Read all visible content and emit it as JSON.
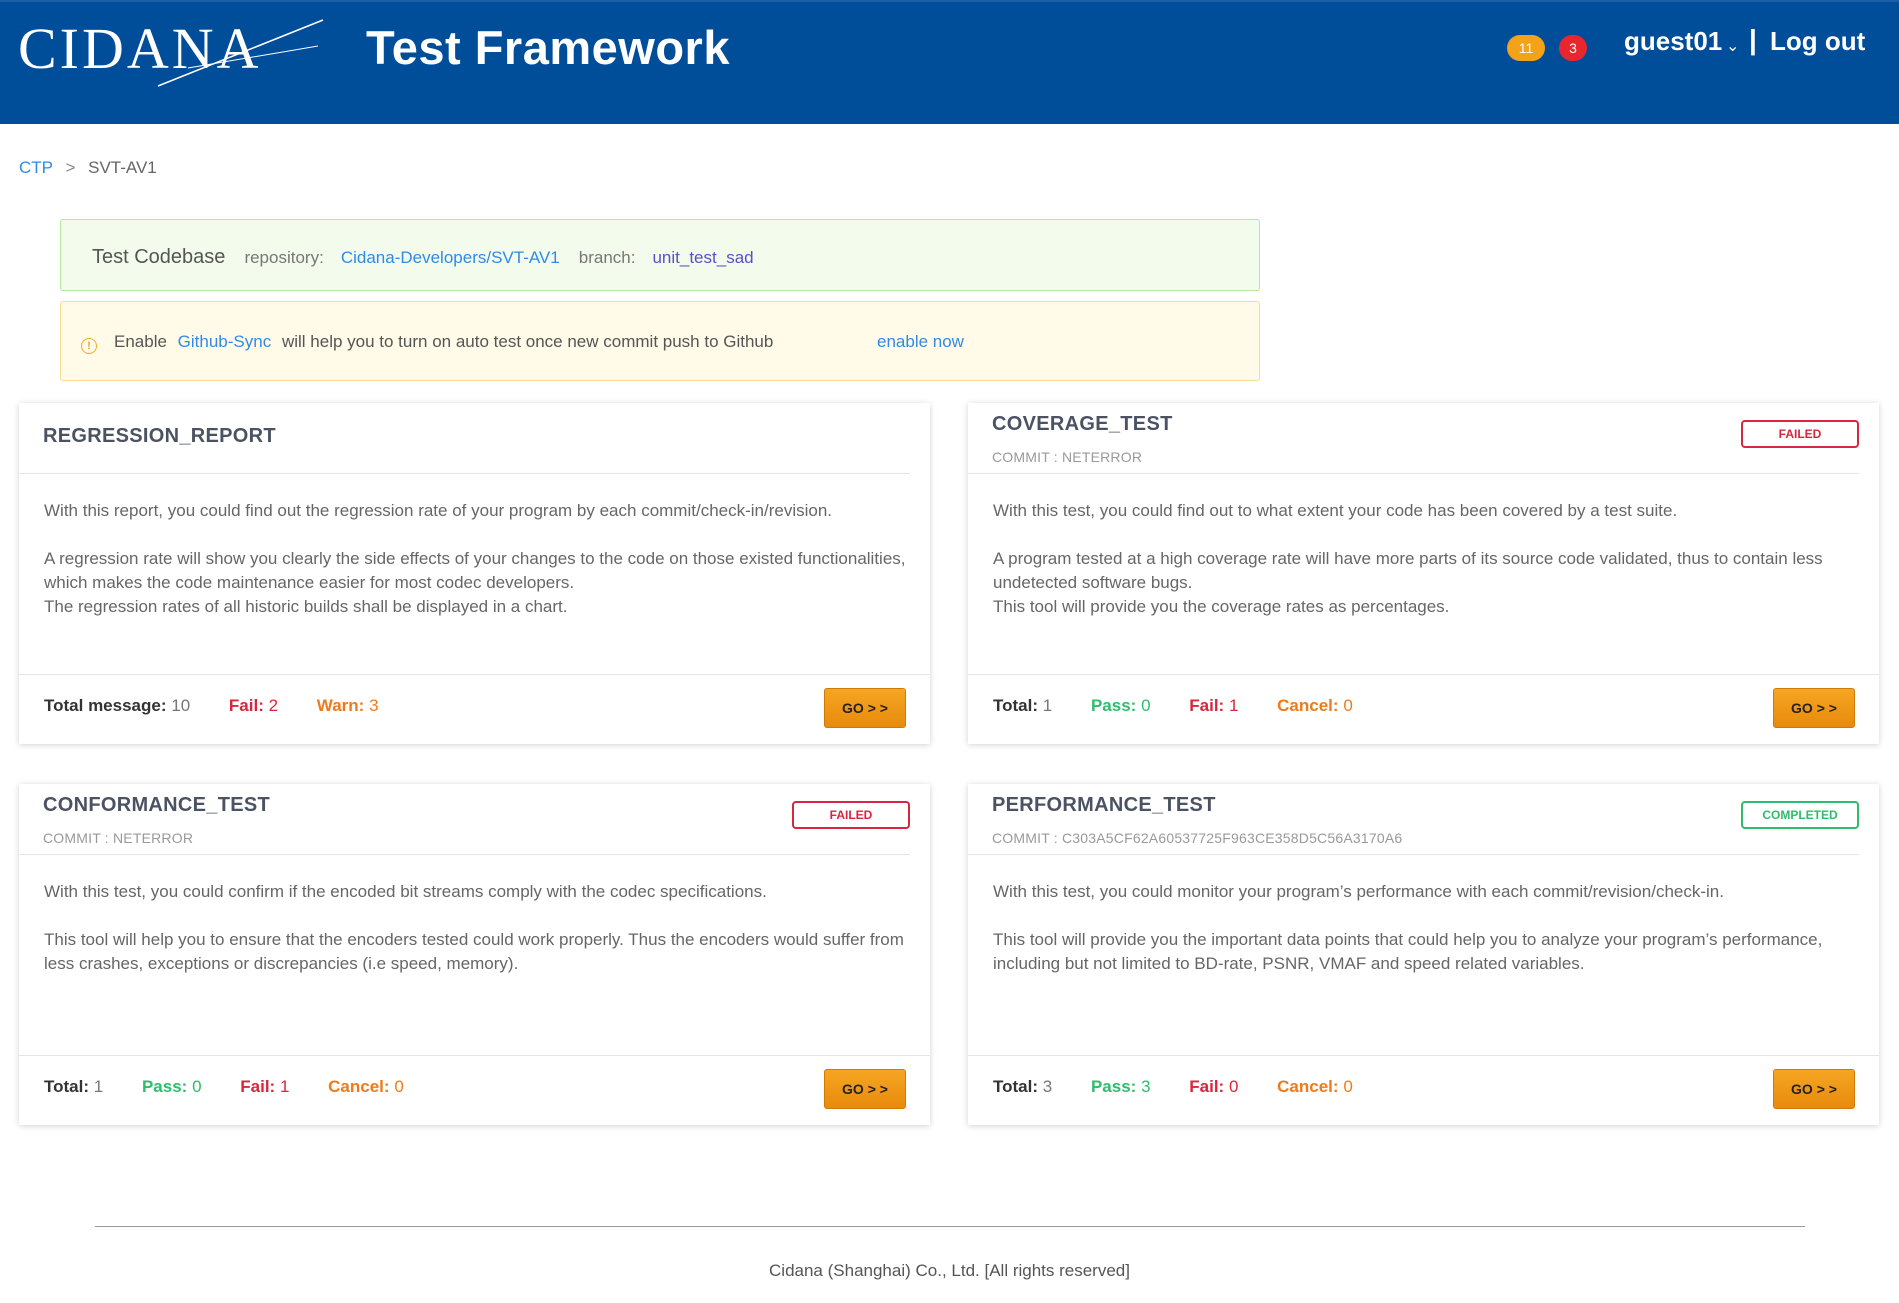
{
  "header": {
    "logo_text": "CIDANA",
    "app_title": "Test Framework",
    "notification_warn_count": "11",
    "notification_error_count": "3",
    "username": "guest01",
    "separator": "|",
    "logout_label": "Log out",
    "colors": {
      "background": "#004d9a",
      "warn_badge": "#f5a21b",
      "error_badge": "#e8262d"
    }
  },
  "breadcrumb": {
    "root": "CTP",
    "separator": ">",
    "current": "SVT-AV1"
  },
  "codebase": {
    "title": "Test Codebase",
    "repo_label": "repository:",
    "repo_value": "Cidana-Developers/SVT-AV1",
    "branch_label": "branch:",
    "branch_value": "unit_test_sad"
  },
  "notice": {
    "icon": "info-icon",
    "prefix": "Enable",
    "link": "Github-Sync",
    "suffix": "will help you to turn on auto test once new commit push to Github",
    "action": "enable now"
  },
  "cards": [
    {
      "title": "REGRESSION_REPORT",
      "body_p1": "With this report, you could find out the regression rate of your program by each commit/check-in/revision.",
      "body_p2_l1": "A regression rate will show you clearly the side effects of your changes to the code on those existed functionalities, which makes the code maintenance easier for most codec developers.",
      "body_p2_l2": "The regression rates of all historic builds shall be displayed in a chart.",
      "stats": {
        "total_label": "Total message:",
        "total_value": "10",
        "fail_label": "Fail:",
        "fail_value": "2",
        "warn_label": "Warn:",
        "warn_value": "3"
      },
      "go_label": "GO > >"
    },
    {
      "title": "COVERAGE_TEST",
      "commit": "COMMIT : NETERROR",
      "status": "FAILED",
      "body_p1": "With this test, you could find out to what extent your code has been covered by a test suite.",
      "body_p2_l1": "A program tested at a high coverage rate will have more parts of its source code validated, thus to contain less undetected software bugs.",
      "body_p2_l2": "This tool will provide you the coverage rates as percentages.",
      "stats": {
        "total_label": "Total:",
        "total_value": "1",
        "pass_label": "Pass:",
        "pass_value": "0",
        "fail_label": "Fail:",
        "fail_value": "1",
        "cancel_label": "Cancel:",
        "cancel_value": "0"
      },
      "go_label": "GO > >"
    },
    {
      "title": "CONFORMANCE_TEST",
      "commit": "COMMIT : NETERROR",
      "status": "FAILED",
      "body_p1": "With this test, you could confirm if the encoded bit streams comply with the codec specifications.",
      "body_p2_l1": "This tool will help you to ensure that the encoders tested could work properly. Thus the encoders would suffer from less crashes, exceptions or discrepancies (i.e speed, memory).",
      "stats": {
        "total_label": "Total:",
        "total_value": "1",
        "pass_label": "Pass:",
        "pass_value": "0",
        "fail_label": "Fail:",
        "fail_value": "1",
        "cancel_label": "Cancel:",
        "cancel_value": "0"
      },
      "go_label": "GO > >"
    },
    {
      "title": "PERFORMANCE_TEST",
      "commit": "COMMIT : C303A5CF62A60537725F963CE358D5C56A3170A6",
      "status": "COMPLETED",
      "body_p1": "With this test, you could monitor your program’s performance with each commit/revision/check-in.",
      "body_p2_l1": "This tool will provide you the important data points that could help you to analyze your program’s performance, including but not limited to BD-rate, PSNR, VMAF and speed related variables.",
      "stats": {
        "total_label": "Total:",
        "total_value": "3",
        "pass_label": "Pass:",
        "pass_value": "3",
        "fail_label": "Fail:",
        "fail_value": "0",
        "cancel_label": "Cancel:",
        "cancel_value": "0"
      },
      "go_label": "GO > >"
    }
  ],
  "footer": {
    "copyright": "Cidana (Shanghai) Co., Ltd. [All rights reserved]"
  }
}
